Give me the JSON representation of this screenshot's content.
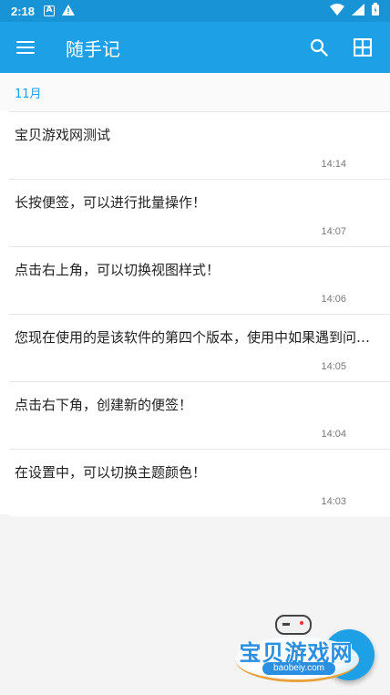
{
  "status_bar": {
    "time": "2:18",
    "icons": [
      "a-notification-icon",
      "warning-icon",
      "wifi-icon",
      "signal-icon",
      "battery-icon"
    ]
  },
  "app_bar": {
    "title": "随手记",
    "color": "#1ea0e6",
    "actions": [
      "search-icon",
      "grid-view-icon"
    ]
  },
  "notes": {
    "month": "11月",
    "items": [
      {
        "text": "宝贝游戏网测试",
        "time": "14:14"
      },
      {
        "text": "长按便签，可以进行批量操作！",
        "time": "14:07"
      },
      {
        "text": "点击右上角，可以切换视图样式！",
        "time": "14:06"
      },
      {
        "text": "您现在使用的是该软件的第四个版本，使用中如果遇到问题，请及时反馈！",
        "time": "14:05"
      },
      {
        "text": "点击右下角，创建新的便签！",
        "time": "14:04"
      },
      {
        "text": "在设置中，可以切换主题颜色！",
        "time": "14:03"
      }
    ]
  },
  "fab": {
    "icon": "add-icon",
    "symbol": "+"
  },
  "watermark": {
    "text": "宝贝游戏网",
    "url": "baobeiy.com"
  }
}
